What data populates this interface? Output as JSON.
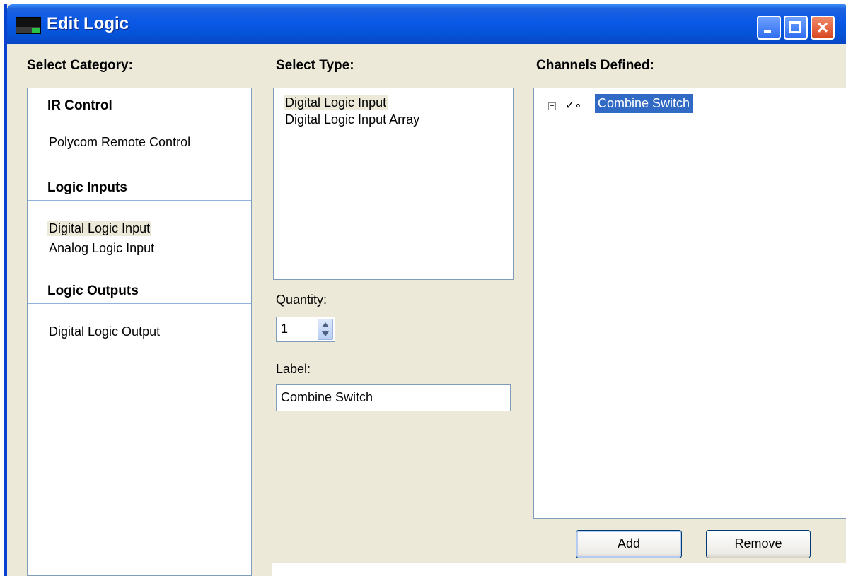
{
  "window": {
    "title": "Edit Logic"
  },
  "category": {
    "label": "Select Category:",
    "groups": [
      {
        "header": "IR Control",
        "items": [
          "Polycom Remote Control"
        ]
      },
      {
        "header": "Logic Inputs",
        "items": [
          "Digital Logic Input",
          "Analog Logic Input"
        ]
      },
      {
        "header": "Logic Outputs",
        "items": [
          "Digital Logic Output"
        ]
      }
    ]
  },
  "type": {
    "label": "Select Type:",
    "items": [
      "Digital Logic Input",
      "Digital Logic Input Array"
    ]
  },
  "quantity": {
    "label": "Quantity:",
    "value": "1"
  },
  "labelField": {
    "label": "Label:",
    "value": "Combine Switch"
  },
  "channels": {
    "label": "Channels Defined:",
    "items": [
      {
        "label": "Combine Switch",
        "icon": "switch-icon",
        "expand": "+"
      }
    ]
  },
  "buttons": {
    "add": "Add",
    "remove": "Remove"
  },
  "icons": {
    "minimize": "minimize-icon",
    "maximize": "maximize-icon",
    "close": "close-icon"
  },
  "colors": {
    "titlebar": "#0a58e6",
    "selection": "#316ac5",
    "window": "#ece9d8"
  }
}
